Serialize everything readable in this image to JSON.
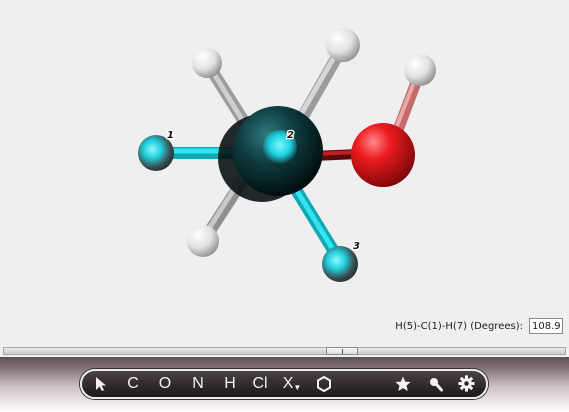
{
  "viewer": {
    "atom_labels": {
      "label_1": "1",
      "label_2": "2",
      "label_3": "3"
    }
  },
  "measurement": {
    "label": "H(5)-C(1)-H(7) (Degrees):",
    "value": "108.9"
  },
  "toolbar": {
    "carbon_label": "C",
    "oxygen_label": "O",
    "nitrogen_label": "N",
    "hydrogen_label": "H",
    "chlorine_label": "Cl",
    "other_element_label": "X"
  },
  "colors": {
    "carbon": "#0c2d30",
    "oxygen": "#e8191e",
    "hydrogen": "#f4f4f4",
    "selected": "#22d8e6"
  }
}
